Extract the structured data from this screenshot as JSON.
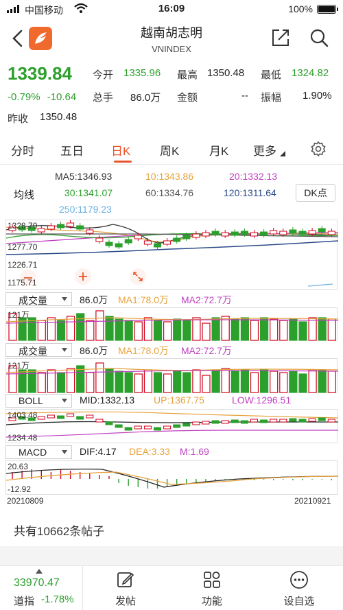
{
  "status_bar": {
    "carrier": "中国移动",
    "time": "16:09",
    "battery": "100%"
  },
  "header": {
    "title": "越南胡志明",
    "subtitle": "VNINDEX"
  },
  "quote": {
    "price": "1339.84",
    "change_pct": "-0.79%",
    "change_abs": "-10.64",
    "prev_close_label": "昨收",
    "prev_close": "1350.48",
    "open_label": "今开",
    "open": "1335.96",
    "high_label": "最高",
    "high": "1350.48",
    "low_label": "最低",
    "low": "1324.82",
    "volume_label": "总手",
    "volume": "86.0万",
    "amount_label": "金额",
    "amount": "--",
    "amplitude_label": "振幅",
    "amplitude": "1.90%"
  },
  "tabs": [
    {
      "label": "分时"
    },
    {
      "label": "五日"
    },
    {
      "label": "日K"
    },
    {
      "label": "周K"
    },
    {
      "label": "月K"
    },
    {
      "label": "更多"
    }
  ],
  "active_tab": "日K",
  "ma_legend": {
    "label": "均线",
    "ma5": "MA5:1346.93",
    "ma10": "10:1343.86",
    "ma20": "20:1332.13",
    "ma30": "30:1341.07",
    "ma60": "60:1334.76",
    "ma120": "120:1311.64",
    "ma250": "250:1179.23",
    "dk_button": "DK点"
  },
  "colors": {
    "up": "#d0021b",
    "down": "#2ca02c",
    "accent": "#e8552a",
    "ma5": "#333333",
    "ma10": "#e6a23c",
    "ma20": "#c040c0",
    "ma30": "#2ca02c",
    "ma60": "#555555",
    "ma120": "#2b4a8a",
    "ma250": "#6ab0e0"
  },
  "kline": {
    "y_labels": [
      "1328.70",
      "1277.70",
      "1226.71",
      "1175.71"
    ]
  },
  "volume1": {
    "selector": "成交量",
    "value": "86.0万",
    "ma1": "MA1:78.0万",
    "ma2": "MA2:72.7万",
    "y_label": "121万"
  },
  "volume2": {
    "selector": "成交量",
    "value": "86.0万",
    "ma1": "MA1:78.0万",
    "ma2": "MA2:72.7万",
    "y_label": "121万"
  },
  "boll": {
    "selector": "BOLL",
    "mid": "MID:1332.13",
    "up": "UP:1367.75",
    "low": "LOW:1296.51",
    "y_top": "1403.48",
    "y_bottom": "1234.48"
  },
  "macd": {
    "selector": "MACD",
    "dif": "DIF:4.17",
    "dea": "DEA:3.33",
    "m": "M:1.69",
    "y_top": "20.63",
    "y_bottom": "-12.92"
  },
  "dates": {
    "start": "20210809",
    "end": "20210921"
  },
  "posts": "共有10662条帖子",
  "bottom_bar": {
    "index_value": "33970.47",
    "index_name": "道指",
    "index_change": "-1.78%",
    "nav": [
      {
        "label": "发帖"
      },
      {
        "label": "功能"
      },
      {
        "label": "设自选"
      }
    ]
  }
}
